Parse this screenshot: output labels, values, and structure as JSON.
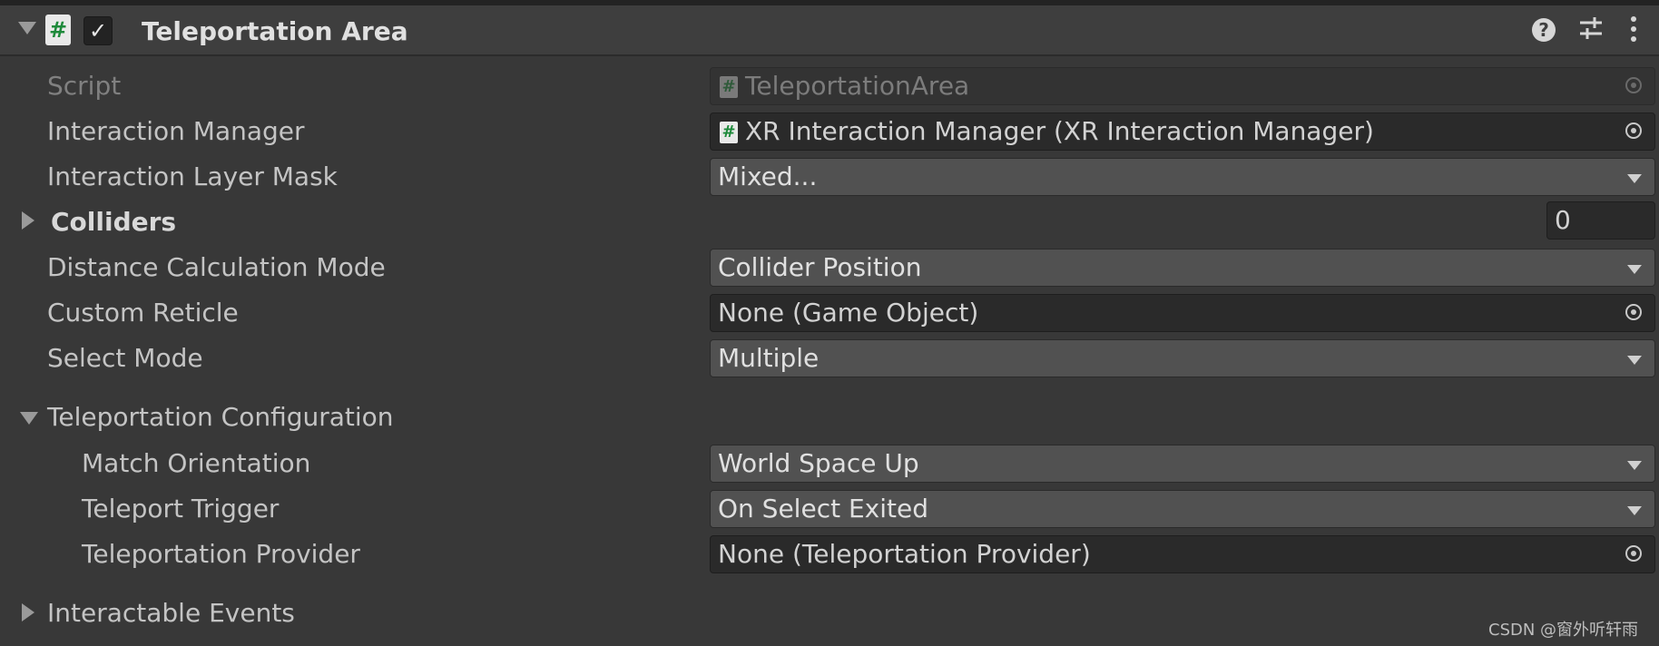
{
  "component": {
    "title": "Teleportation Area",
    "enabled_checkmark": "✓",
    "script_glyph": "#"
  },
  "header_icons": {
    "help": "?",
    "presets": "⊶",
    "menu": "⋮"
  },
  "properties": {
    "script": {
      "label": "Script",
      "value": "TeleportationArea"
    },
    "interaction_manager": {
      "label": "Interaction Manager",
      "value": "XR Interaction Manager (XR Interaction Manager)"
    },
    "interaction_layer_mask": {
      "label": "Interaction Layer Mask",
      "value": "Mixed..."
    },
    "colliders": {
      "label": "Colliders",
      "count": "0"
    },
    "distance_calculation_mode": {
      "label": "Distance Calculation Mode",
      "value": "Collider Position"
    },
    "custom_reticle": {
      "label": "Custom Reticle",
      "value": "None (Game Object)"
    },
    "select_mode": {
      "label": "Select Mode",
      "value": "Multiple"
    }
  },
  "teleportation_configuration": {
    "label": "Teleportation Configuration",
    "match_orientation": {
      "label": "Match Orientation",
      "value": "World Space Up"
    },
    "teleport_trigger": {
      "label": "Teleport Trigger",
      "value": "On Select Exited"
    },
    "teleportation_provider": {
      "label": "Teleportation Provider",
      "value": "None (Teleportation Provider)"
    }
  },
  "interactable_events": {
    "label": "Interactable Events"
  },
  "watermark": "CSDN @窗外听轩雨"
}
